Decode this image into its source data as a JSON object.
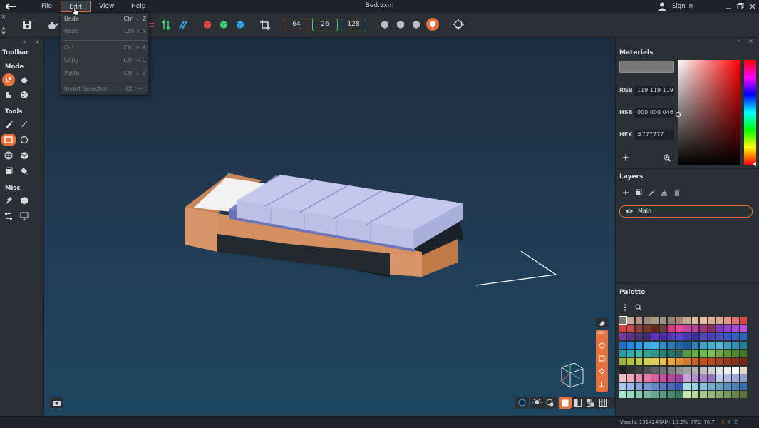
{
  "window": {
    "title": "Bed.vxm",
    "sign_in": "Sign In"
  },
  "menu": {
    "file": "File",
    "edit": "Edit",
    "view": "View",
    "help": "Help",
    "edit_items": [
      {
        "label": "Undo",
        "shortcut": "Ctrl + Z",
        "enabled": true
      },
      {
        "label": "Redo",
        "shortcut": "Ctrl + Y",
        "enabled": false
      },
      {
        "label": "Cut",
        "shortcut": "Ctrl + X",
        "enabled": false
      },
      {
        "label": "Copy",
        "shortcut": "Ctrl + C",
        "enabled": false
      },
      {
        "label": "Paste",
        "shortcut": "Ctrl + V",
        "enabled": false
      },
      {
        "label": "Invert Selection",
        "shortcut": "Ctrl + I",
        "enabled": false
      }
    ]
  },
  "toolbar": {
    "dim_x": "64",
    "dim_y": "26",
    "dim_z": "128"
  },
  "left_panel": {
    "title": "Toolbar",
    "mode": "Mode",
    "tools": "Tools",
    "misc": "Misc"
  },
  "materials": {
    "title": "Materials",
    "rgb_label": "RGB",
    "rgb_value": "119 119 119",
    "hsb_label": "HSB",
    "hsb_value": "000 000 046",
    "hex_label": "HEX",
    "hex_value": "#777777",
    "current_color": "#777777"
  },
  "layers": {
    "title": "Layers",
    "items": [
      {
        "name": "Main"
      }
    ]
  },
  "palette": {
    "title": "Palette",
    "colors": [
      "#777777",
      "#c8a898",
      "#b49488",
      "#a08880",
      "#a89c80",
      "#9c9488",
      "#908478",
      "#a88474",
      "#c8a890",
      "#e0b8a0",
      "#e8c0a8",
      "#d8b098",
      "#e0a890",
      "#e89880",
      "#e87070",
      "#e04848",
      "#d84040",
      "#c84850",
      "#904038",
      "#783828",
      "#682818",
      "#704040",
      "#d03878",
      "#e84898",
      "#d040a0",
      "#b84098",
      "#a03878",
      "#883060",
      "#8838c8",
      "#9840d0",
      "#a848d8",
      "#b850e0",
      "#7838a0",
      "#603088",
      "#503080",
      "#402878",
      "#6030c0",
      "#5028a8",
      "#5838b8",
      "#6040c8",
      "#4838b8",
      "#4030a8",
      "#5048c0",
      "#4840b8",
      "#4050c8",
      "#3858c8",
      "#3060c8",
      "#2868c0",
      "#2070d0",
      "#2888e0",
      "#3098e8",
      "#38a8e8",
      "#40b0f0",
      "#3090d0",
      "#2878b8",
      "#2068a8",
      "#1858a0",
      "#3080b8",
      "#40a0c8",
      "#48b0d0",
      "#50b8d8",
      "#40a0c0",
      "#3090b0",
      "#208098",
      "#28a0a0",
      "#30b0a8",
      "#38b8a0",
      "#30a890",
      "#289880",
      "#208870",
      "#187860",
      "#306858",
      "#50a040",
      "#60b048",
      "#70b850",
      "#80c058",
      "#70a848",
      "#609838",
      "#508830",
      "#407828",
      "#a0b038",
      "#b0c040",
      "#c0c848",
      "#d0d050",
      "#e0d058",
      "#e8c048",
      "#e8a838",
      "#e09030",
      "#d87828",
      "#d06020",
      "#c85018",
      "#b84818",
      "#a84018",
      "#983818",
      "#883010",
      "#782810",
      "#202020",
      "#303030",
      "#404040",
      "#505050",
      "#606060",
      "#707070",
      "#808080",
      "#909090",
      "#a0a0a0",
      "#b0b0b0",
      "#c0c0c0",
      "#d0d0d0",
      "#e0e0e0",
      "#f0f0f0",
      "#ffffff",
      "#e8d8c8",
      "#f0c0c0",
      "#f0a8b8",
      "#e890b0",
      "#e878a8",
      "#d860a0",
      "#c850a0",
      "#b04898",
      "#a040a0",
      "#c8a0d8",
      "#b890d0",
      "#a880c8",
      "#9870c0",
      "#c0c8e8",
      "#b0b8e0",
      "#a0a8d8",
      "#9098d0",
      "#a8c8f0",
      "#98b8e8",
      "#88a8e0",
      "#7898d8",
      "#6888d0",
      "#5878c8",
      "#4868c0",
      "#3858b8",
      "#a8e0e8",
      "#98d0e0",
      "#88c0d8",
      "#78b0d0",
      "#68a0c8",
      "#5890c0",
      "#4880b8",
      "#3870b0",
      "#a8e8d0",
      "#98d8c0",
      "#88c8b0",
      "#78b8a0",
      "#68a890",
      "#589880",
      "#488870",
      "#387860",
      "#c8e8a8",
      "#b8d898",
      "#a8c888",
      "#98b878",
      "#88a868",
      "#789858",
      "#688848",
      "#587838"
    ]
  },
  "status": {
    "voxels": "Voxels: 131424",
    "ram": "RAM: 10.2%",
    "fps": "FPS: 76.7",
    "axis_x": "X",
    "axis_y": "Y",
    "axis_z": "Z"
  },
  "colors": {
    "accent": "#e8703a",
    "panel": "#2b3035"
  }
}
